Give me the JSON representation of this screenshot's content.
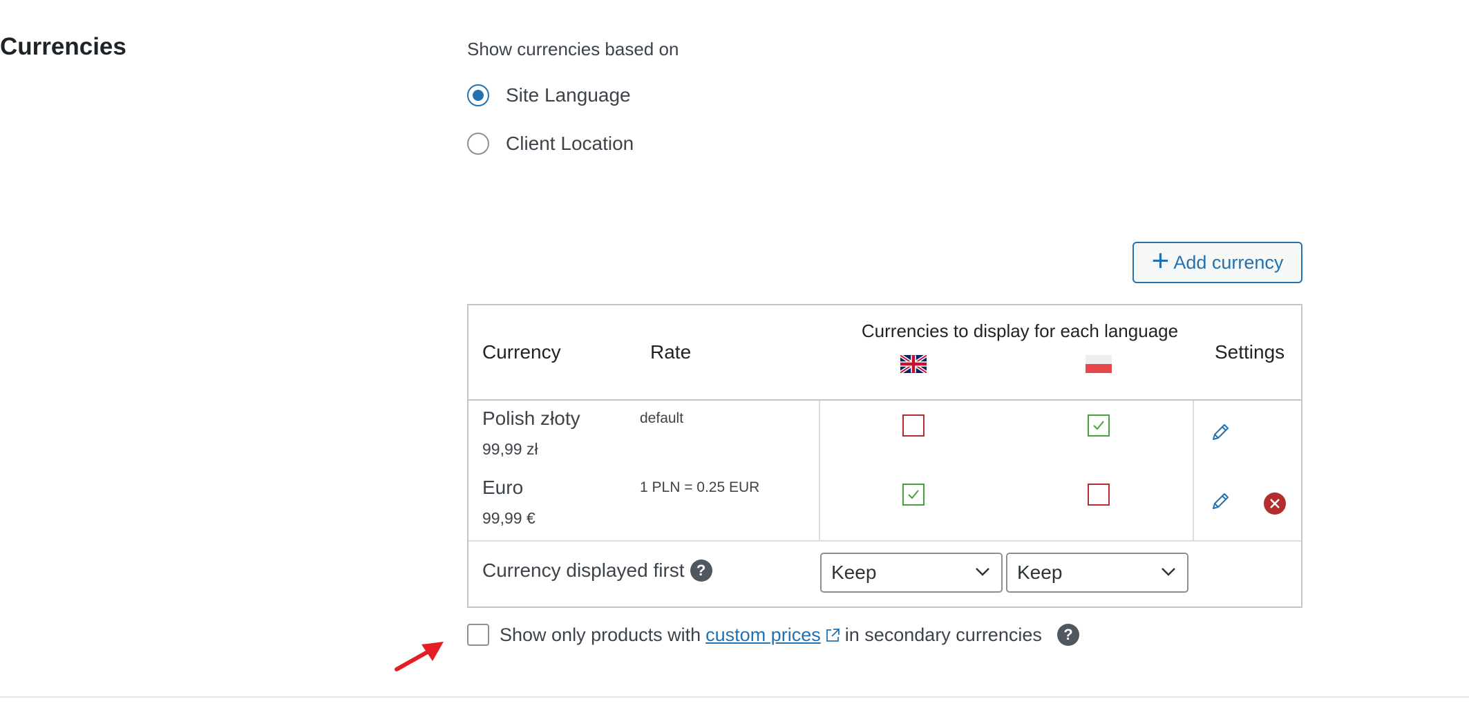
{
  "section": {
    "title": "Currencies"
  },
  "display_mode": {
    "label": "Show currencies based on",
    "options": [
      {
        "label": "Site Language",
        "selected": true
      },
      {
        "label": "Client Location",
        "selected": false
      }
    ]
  },
  "toolbar": {
    "add_currency_label": "Add currency"
  },
  "table": {
    "headers": {
      "currency": "Currency",
      "rate": "Rate",
      "languages": "Currencies to display for each language",
      "settings": "Settings"
    },
    "languages": [
      "en-flag-icon",
      "pl-flag-icon"
    ],
    "rows": [
      {
        "name": "Polish złoty",
        "price": "99,99 zł",
        "rate": "default",
        "display": [
          false,
          true
        ],
        "deletable": false
      },
      {
        "name": "Euro",
        "price": "99,99 €",
        "rate": "1 PLN = 0.25 EUR",
        "display": [
          true,
          false
        ],
        "deletable": true
      }
    ],
    "footer": {
      "label": "Currency displayed first",
      "selects": [
        "Keep",
        "Keep"
      ]
    }
  },
  "custom_prices": {
    "checked": false,
    "text_before": "Show only products with",
    "link_text": "custom prices",
    "text_after": "in secondary currencies"
  },
  "colors": {
    "accent": "#2271b1",
    "unchecked_border": "#b32d2e",
    "checked_border": "#46a33a",
    "delete": "#b32d2e",
    "arrow": "#e41e25"
  }
}
